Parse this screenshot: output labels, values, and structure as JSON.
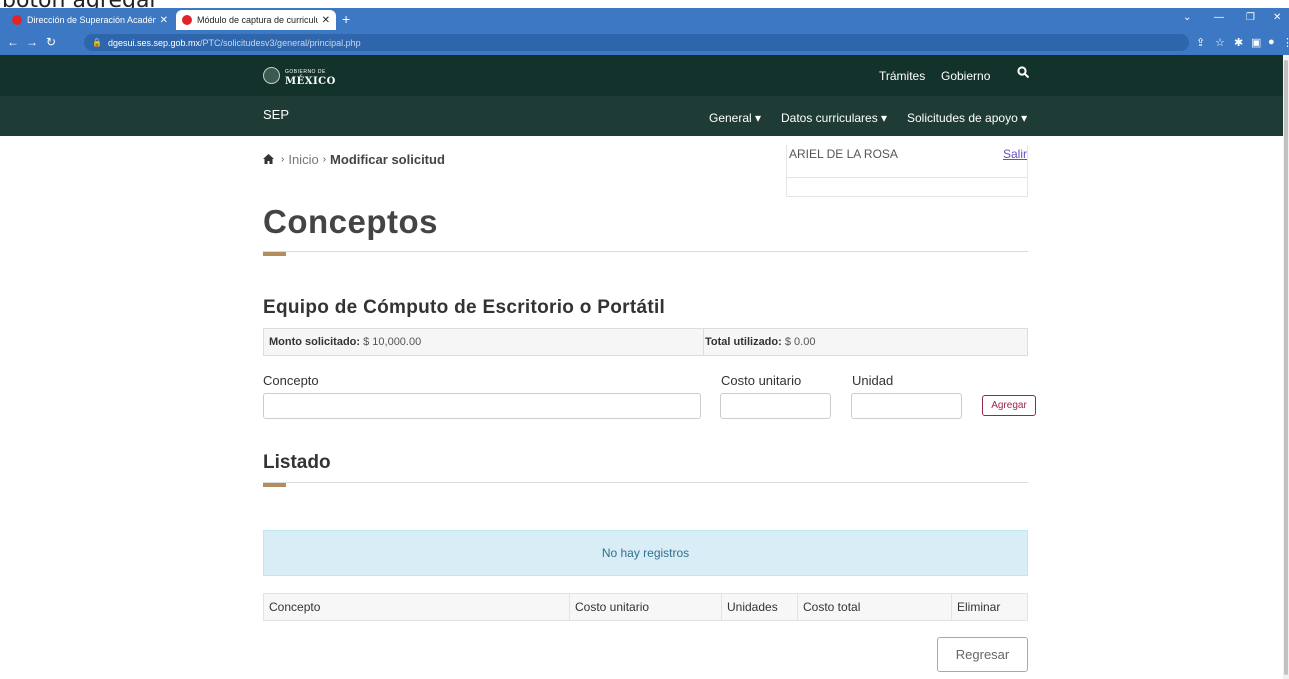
{
  "caption": "boton agregar",
  "browser": {
    "tabs": [
      {
        "title": "Dirección de Superación Académ",
        "active": false
      },
      {
        "title": "Módulo de captura de curriculum",
        "active": true
      }
    ],
    "url_host": "dgesui.ses.sep.gob.mx",
    "url_path": "/PTC/solicitudesv3/general/principal.php"
  },
  "gob_header": {
    "logo_small": "GOBIERNO DE",
    "logo_big": "MÉXICO",
    "nav": [
      "Trámites",
      "Gobierno"
    ]
  },
  "sep_header": {
    "title": "SEP",
    "menu": [
      "General",
      "Datos curriculares",
      "Solicitudes de apoyo"
    ]
  },
  "breadcrumb": {
    "home": "Inicio",
    "current": "Modificar solicitud"
  },
  "user": {
    "name": "ARIEL DE LA ROSA",
    "logout": "Salir"
  },
  "page_title": "Conceptos",
  "section_title": "Equipo de Cómputo de Escritorio o Portátil",
  "amounts": {
    "requested_label": "Monto solicitado:",
    "requested_value": "$ 10,000.00",
    "used_label": "Total utilizado:",
    "used_value": "$ 0.00"
  },
  "form": {
    "concept_label": "Concepto",
    "unit_cost_label": "Costo unitario",
    "unit_label": "Unidad",
    "concept_value": "",
    "unit_cost_value": "",
    "unit_value": "",
    "add_button": "Agregar"
  },
  "listado": {
    "title": "Listado",
    "empty_message": "No hay registros",
    "columns": [
      "Concepto",
      "Costo unitario",
      "Unidades",
      "Costo total",
      "Eliminar"
    ]
  },
  "back_button": "Regresar",
  "colors": {
    "gob_green": "#13322b",
    "sep_green": "#1e3c35",
    "accent_gold": "#b38e5d",
    "add_button": "#9d2449",
    "alert_bg": "#d9edf7"
  }
}
